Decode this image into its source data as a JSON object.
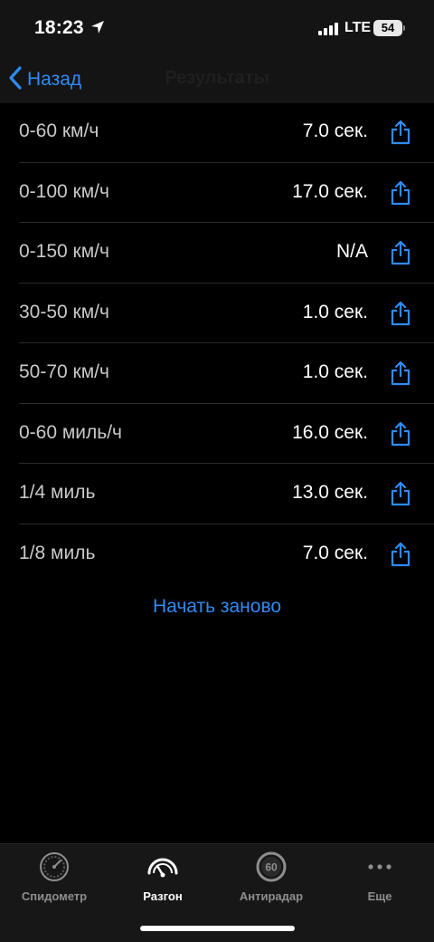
{
  "status": {
    "time": "18:23",
    "network": "LTE",
    "battery": "54"
  },
  "nav": {
    "back_label": "Назад",
    "title": "Результаты"
  },
  "results": [
    {
      "label": "0-60 км/ч",
      "value": "7.0 сек."
    },
    {
      "label": "0-100 км/ч",
      "value": "17.0 сек."
    },
    {
      "label": "0-150 км/ч",
      "value": "N/A"
    },
    {
      "label": "30-50 км/ч",
      "value": "1.0 сек."
    },
    {
      "label": "50-70 км/ч",
      "value": "1.0 сек."
    },
    {
      "label": "0-60 миль/ч",
      "value": "16.0 сек."
    },
    {
      "label": "1/4 миль",
      "value": "13.0 сек."
    },
    {
      "label": "1/8 миль",
      "value": "7.0 сек."
    }
  ],
  "restart_label": "Начать заново",
  "tabs": [
    {
      "label": "Спидометр",
      "icon": "speedometer-icon",
      "active": false
    },
    {
      "label": "Разгон",
      "icon": "acceleration-gauge-icon",
      "active": true
    },
    {
      "label": "Антирадар",
      "icon": "speed-limit-60-icon",
      "active": false,
      "badge": "60"
    },
    {
      "label": "Еще",
      "icon": "more-dots-icon",
      "active": false
    }
  ],
  "colors": {
    "accent": "#2f8bf3",
    "background": "#000000",
    "bar": "#141414"
  }
}
